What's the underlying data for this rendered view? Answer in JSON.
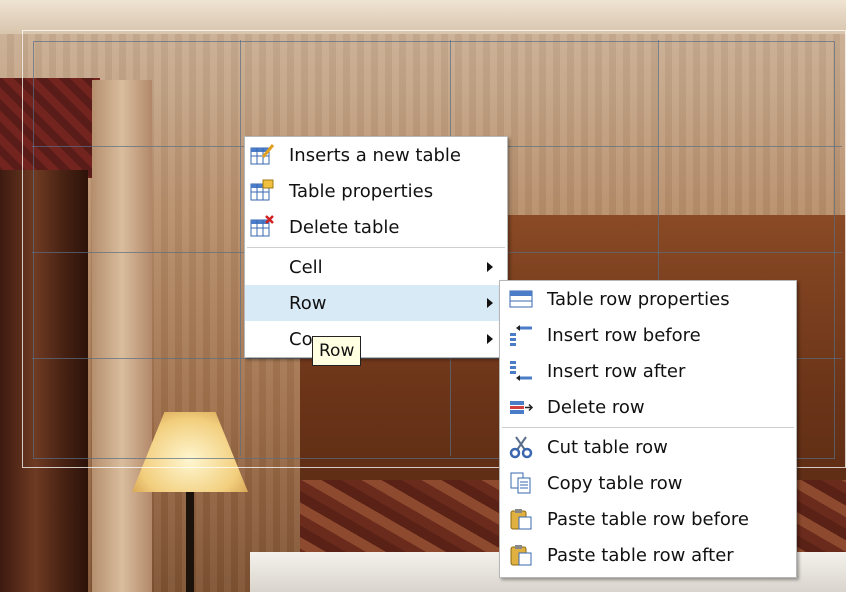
{
  "context_menu": {
    "items": [
      {
        "label": "Inserts a new table",
        "icon": "insert-table-icon"
      },
      {
        "label": "Table properties",
        "icon": "table-properties-icon"
      },
      {
        "label": "Delete table",
        "icon": "delete-table-icon"
      },
      {
        "label": "Cell",
        "submenu": true
      },
      {
        "label": "Row",
        "submenu": true,
        "highlighted": true
      },
      {
        "label": "Co",
        "submenu": true
      }
    ]
  },
  "tooltip": {
    "text": "Row"
  },
  "row_submenu": {
    "items": [
      {
        "label": "Table row properties",
        "icon": "table-row-properties-icon"
      },
      {
        "label": "Insert row before",
        "icon": "insert-row-before-icon"
      },
      {
        "label": "Insert row after",
        "icon": "insert-row-after-icon"
      },
      {
        "label": "Delete row",
        "icon": "delete-row-icon"
      },
      {
        "label": "Cut table row",
        "icon": "scissors-icon"
      },
      {
        "label": "Copy table row",
        "icon": "copy-icon"
      },
      {
        "label": "Paste table row before",
        "icon": "paste-icon"
      },
      {
        "label": "Paste table row after",
        "icon": "paste-icon"
      }
    ]
  },
  "colors": {
    "highlight": "#d9eaf7",
    "tooltip_bg": "#ffffe1"
  }
}
